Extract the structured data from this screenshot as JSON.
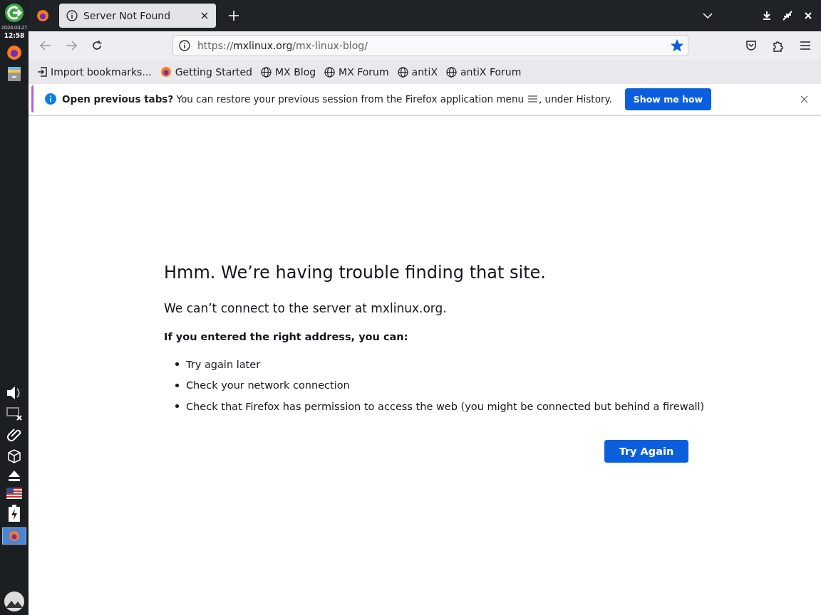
{
  "panel": {
    "date": "2024-03-27",
    "time": "12:58"
  },
  "tabs": [
    {
      "title": "Server Not Found",
      "selected": true
    }
  ],
  "address_bar": {
    "scheme": "https://",
    "host": "mxlinux.org",
    "path": "/mx-linux-blog/",
    "bookmarked": true
  },
  "bookmarks": [
    {
      "label": "Import bookmarks...",
      "kind": "import"
    },
    {
      "label": "Getting Started",
      "kind": "firefox"
    },
    {
      "label": "MX Blog",
      "kind": "globe"
    },
    {
      "label": "MX Forum",
      "kind": "globe"
    },
    {
      "label": "antiX",
      "kind": "globe"
    },
    {
      "label": "antiX Forum",
      "kind": "globe"
    }
  ],
  "notification": {
    "message_start": "**Open previous tabs?** You can restore your previous session from the Firefox application menu",
    "message_end": ", under History.",
    "button": "Show me how"
  },
  "error_page": {
    "title": "Hmm. We’re having trouble finding that site.",
    "subtitle": "We can’t connect to the server at mxlinux.org.",
    "hint": "If you entered the right address, you can:",
    "suggestions": [
      "Try again later",
      "Check your network connection",
      "Check that Firefox has permission to access the web (you might be connected but behind a firewall)"
    ],
    "button": "Try Again"
  }
}
